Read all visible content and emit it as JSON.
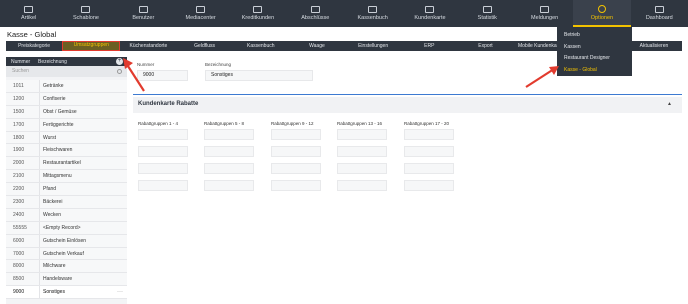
{
  "topnav": {
    "items": [
      {
        "label": "Artikel",
        "icon": "box-icon"
      },
      {
        "label": "Schablone",
        "icon": "template-icon"
      },
      {
        "label": "Benutzer",
        "icon": "users-icon"
      },
      {
        "label": "Mediacenter",
        "icon": "media-icon"
      },
      {
        "label": "Kreditkunden",
        "icon": "credit-card-icon"
      },
      {
        "label": "Abschlüsse",
        "icon": "report-icon"
      },
      {
        "label": "Kassenbuch",
        "icon": "cashbook-icon"
      },
      {
        "label": "Kundenkarte",
        "icon": "customer-card-icon"
      },
      {
        "label": "Statistik",
        "icon": "chart-icon"
      },
      {
        "label": "Meldungen",
        "icon": "mail-icon"
      },
      {
        "label": "Optionen",
        "icon": "gear-icon"
      },
      {
        "label": "Dashboard",
        "icon": "monitor-icon"
      }
    ],
    "active": "Optionen",
    "accent": "#f2c200"
  },
  "dropdown": {
    "items": [
      "Betrieb",
      "Kassen",
      "Restaurant Designer",
      "Kasse - Global"
    ],
    "selected": "Kasse - Global"
  },
  "page_title": "Kasse - Global",
  "tabs": {
    "items": [
      "Preiskategorie",
      "Umsatzgruppen",
      "Küchenstandorte",
      "Geldfluss",
      "Kassenbuch",
      "Waage",
      "Einstellungen",
      "ERP",
      "Export",
      "Mobile Kundenkarten",
      "",
      "Aktualisieren"
    ],
    "active": "Umsatzgruppen"
  },
  "list": {
    "header_number": "Nummer",
    "header_name": "Bezeichnung",
    "add_label": "+",
    "search_placeholder": "Suchen",
    "rows": [
      {
        "num": "1011",
        "name": "Getränke"
      },
      {
        "num": "1200",
        "name": "Confiserie"
      },
      {
        "num": "1500",
        "name": "Obst / Gemüse"
      },
      {
        "num": "1700",
        "name": "Fertiggerichte"
      },
      {
        "num": "1800",
        "name": "Wurst"
      },
      {
        "num": "1900",
        "name": "Fleischwaren"
      },
      {
        "num": "2000",
        "name": "Restaurantartikel"
      },
      {
        "num": "2100",
        "name": "Mittagsmenu"
      },
      {
        "num": "2200",
        "name": "Pfand"
      },
      {
        "num": "2300",
        "name": "Bäckerei"
      },
      {
        "num": "2400",
        "name": "Wecken"
      },
      {
        "num": "55555",
        "name": "<Empty Record>"
      },
      {
        "num": "6000",
        "name": "Gutschein Einlösen"
      },
      {
        "num": "7000",
        "name": "Gutschein Verkauf"
      },
      {
        "num": "8000",
        "name": "Milchware"
      },
      {
        "num": "8500",
        "name": "Handelsware"
      },
      {
        "num": "9000",
        "name": "Sonstiges",
        "selected": true
      }
    ]
  },
  "form": {
    "number_label": "Nummer",
    "number_value": "9000",
    "name_label": "Bezeichnung",
    "name_value": "Sonstiges"
  },
  "section": {
    "title": "Kundenkarte Rabatte",
    "caret": "▲",
    "columns": [
      "Rabattgruppen 1 - 4",
      "Rabattgruppen 5 - 8",
      "Rabattgruppen 9 - 12",
      "Rabattgruppen 13 - 16",
      "Rabattgruppen 17 - 20"
    ]
  },
  "colors": {
    "nav_bg": "#2f3640",
    "annotation_red": "#e23b2e",
    "divider_blue": "#3d7ad1"
  }
}
